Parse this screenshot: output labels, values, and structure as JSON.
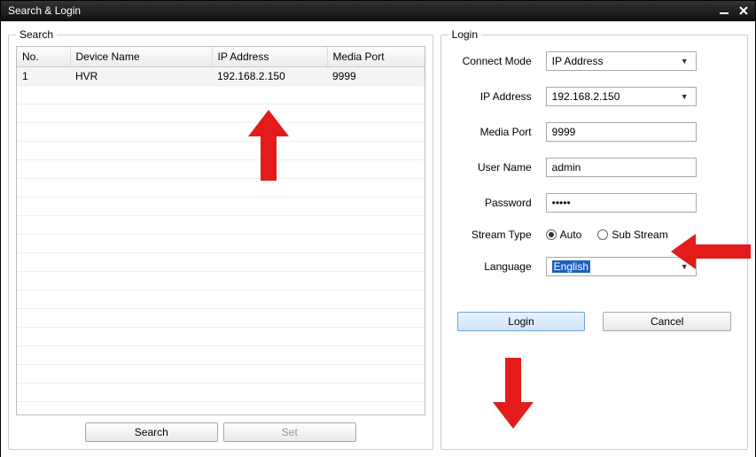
{
  "window": {
    "title": "Search & Login"
  },
  "search": {
    "legend": "Search",
    "columns": {
      "no": "No.",
      "device": "Device Name",
      "ip": "IP Address",
      "port": "Media Port"
    },
    "rows": [
      {
        "no": "1",
        "device": "HVR",
        "ip": "192.168.2.150",
        "port": "9999"
      }
    ],
    "buttons": {
      "search": "Search",
      "set": "Set"
    }
  },
  "login": {
    "legend": "Login",
    "labels": {
      "connect_mode": "Connect Mode",
      "ip_address": "IP Address",
      "media_port": "Media Port",
      "user_name": "User Name",
      "password": "Password",
      "stream_type": "Stream Type",
      "language": "Language"
    },
    "values": {
      "connect_mode": "IP Address",
      "ip_address": "192.168.2.150",
      "media_port": "9999",
      "user_name": "admin",
      "password": "•••••",
      "stream_auto": "Auto",
      "stream_sub": "Sub Stream",
      "language": "English"
    },
    "buttons": {
      "login": "Login",
      "cancel": "Cancel"
    }
  }
}
